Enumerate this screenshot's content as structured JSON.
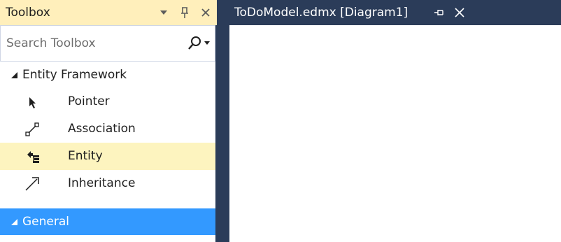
{
  "toolbox": {
    "title": "Toolbox",
    "search": {
      "placeholder": "Search Toolbox",
      "value": ""
    },
    "groups": [
      {
        "label": "Entity Framework",
        "expanded": true,
        "items": [
          {
            "label": "Pointer",
            "icon": "pointer-icon"
          },
          {
            "label": "Association",
            "icon": "association-icon"
          },
          {
            "label": "Entity",
            "icon": "entity-icon",
            "highlighted": true
          },
          {
            "label": "Inheritance",
            "icon": "inheritance-icon"
          }
        ]
      },
      {
        "label": "General",
        "expanded": true,
        "selected": true,
        "items": []
      }
    ]
  },
  "document": {
    "tabs": [
      {
        "title": "ToDoModel.edmx [Diagram1]",
        "active": true
      }
    ]
  },
  "colors": {
    "frame": "#2b3c59",
    "toolbox_header": "#ffefbb",
    "hover_highlight": "#fdf4bf",
    "selection": "#3399ff"
  }
}
